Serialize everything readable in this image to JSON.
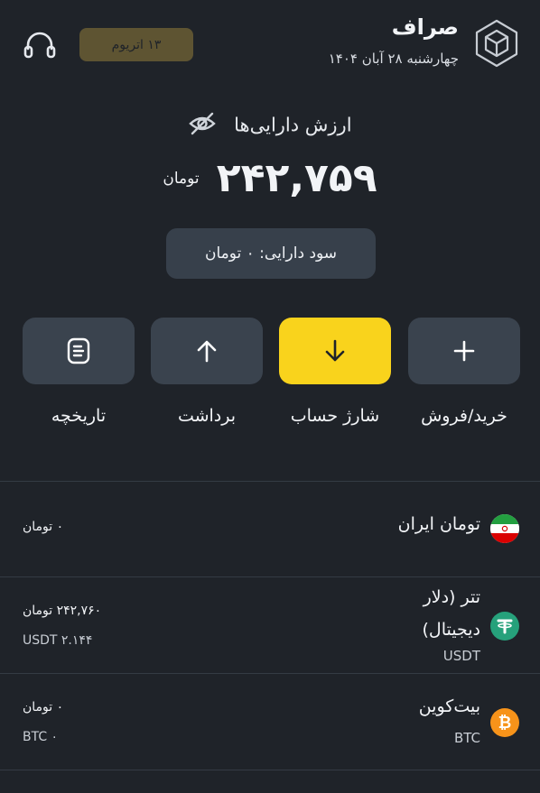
{
  "header": {
    "app_title": "صراف",
    "date": "چهارشنبه ۲۸ آبان ۱۴۰۴",
    "badge": "۱۳ اتریوم"
  },
  "balance": {
    "label": "ارزش دارایی‌ها",
    "amount": "۲۴۲,۷۵۹",
    "unit": "تومان",
    "profit": "سود دارایی:  ۰ تومان"
  },
  "actions": [
    {
      "label": "خرید/فروش",
      "icon": "plus-icon"
    },
    {
      "label": "شارژ حساب",
      "icon": "arrow-down-icon"
    },
    {
      "label": "برداشت",
      "icon": "arrow-up-icon"
    },
    {
      "label": "تاریخچه",
      "icon": "history-icon"
    }
  ],
  "assets": [
    {
      "name": "تومان ایران",
      "symbol": "",
      "value": "۰ تومان",
      "sub": "",
      "icon": "iran-flag-icon"
    },
    {
      "name": "تتر (دلار دیجیتال)",
      "symbol": "USDT",
      "value": "۲۴۲,۷۶۰ تومان",
      "sub": "USDT ۲.۱۴۴",
      "icon": "tether-icon"
    },
    {
      "name": "بیت‌کوین",
      "symbol": "BTC",
      "value": "۰ تومان",
      "sub": "BTC ۰",
      "icon": "bitcoin-icon"
    }
  ],
  "colors": {
    "background": "#1f2329",
    "accent": "#f9d31c",
    "card": "#3a434e",
    "tether": "#26a17b",
    "bitcoin": "#f7931a"
  }
}
